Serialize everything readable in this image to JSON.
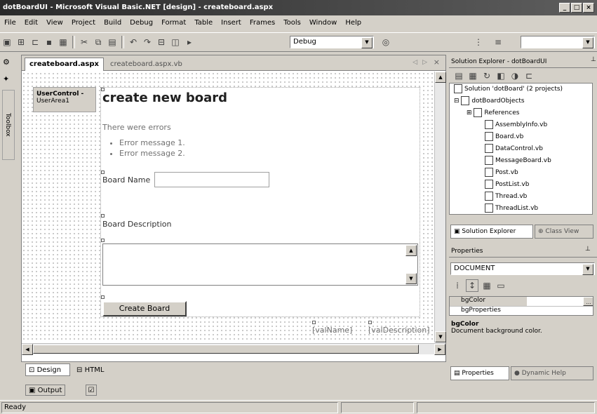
{
  "window": {
    "title": "dotBoardUI - Microsoft Visual Basic.NET [design] - createboard.aspx"
  },
  "menu": [
    "File",
    "Edit",
    "View",
    "Project",
    "Build",
    "Debug",
    "Format",
    "Table",
    "Insert",
    "Frames",
    "Tools",
    "Window",
    "Help"
  ],
  "toolbar": {
    "config_value": "Debug"
  },
  "sidestrip": {
    "toolbox_label": "Toolbox"
  },
  "doc_tabs": {
    "active": "createboard.aspx",
    "other": "createboard.aspx.vb"
  },
  "designer": {
    "usercontrol_title": "UserControl -",
    "usercontrol_sub": "UserArea1",
    "heading": "create new board",
    "errors_label": "There were errors",
    "errors": [
      "Error message 1.",
      "Error message 2."
    ],
    "board_name_label": "Board Name",
    "board_description_label": "Board Description",
    "create_button": "Create Board",
    "val_name": "[valName]",
    "val_description": "[valDescription]"
  },
  "view_tabs": {
    "design": "Design",
    "html": "HTML"
  },
  "output": {
    "label": "Output"
  },
  "status": {
    "text": "Ready"
  },
  "solution_explorer": {
    "title": "Solution Explorer - dotBoardUI",
    "solution": "Solution 'dotBoard' (2 projects)",
    "project": "dotBoardObjects",
    "references": "References",
    "files": [
      "AssemblyInfo.vb",
      "Board.vb",
      "DataControl.vb",
      "MessageBoard.vb",
      "Post.vb",
      "PostList.vb",
      "Thread.vb",
      "ThreadList.vb"
    ],
    "tab_solution": "Solution Explorer",
    "tab_class": "Class View"
  },
  "properties": {
    "title": "Properties",
    "object": "DOCUMENT",
    "rows": [
      {
        "name": "bgColor",
        "value": ""
      },
      {
        "name": "bgProperties",
        "value": ""
      }
    ],
    "desc_title": "bgColor",
    "desc_text": "Document background color.",
    "tab_properties": "Properties",
    "tab_help": "Dynamic Help"
  }
}
